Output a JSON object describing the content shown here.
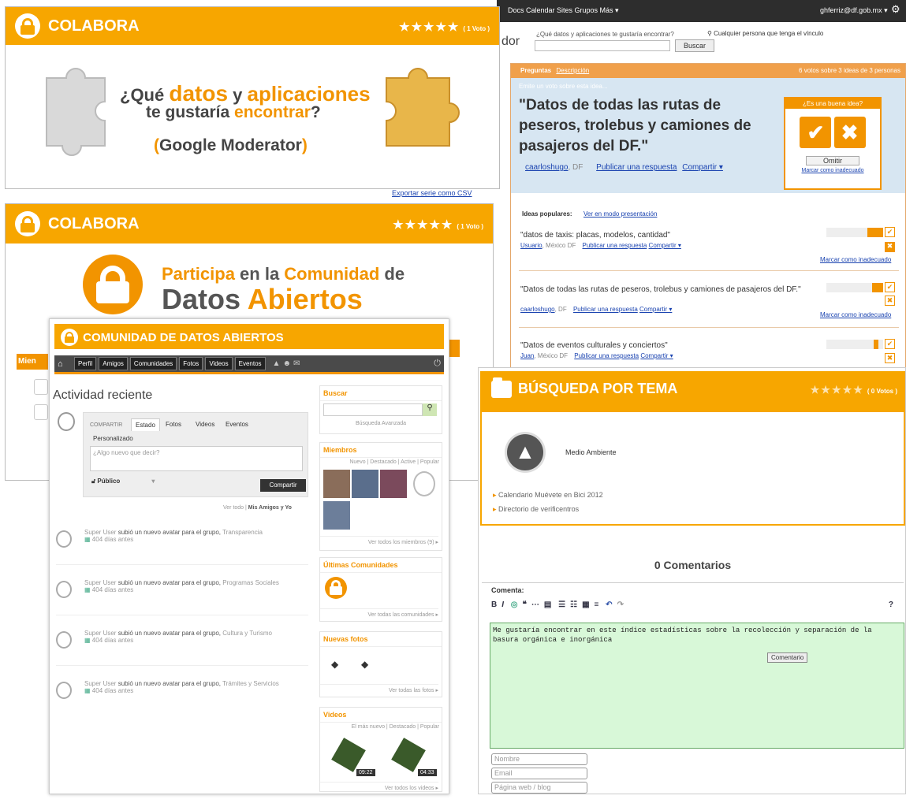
{
  "moderator": {
    "topnav": "Docs  Calendar  Sites  Grupos  Más ▾",
    "account": "ghferriz@df.gob.mx ▾",
    "brand_fragment": "dor",
    "search_prompt": "¿Qué datos y aplicaciones te gustaría encontrar?",
    "share_note": "Cualquier persona que tenga el vínculo",
    "search_button": "Buscar",
    "tab_questions": "Preguntas",
    "tab_description": "Descripción",
    "votes_summary": "6 votos sobre 3 ideas de 3 personas",
    "emit_vote": "Emite un voto sobre esta idea...",
    "idea_title": "\"Datos de todas las rutas de peseros, trolebus y camiones de pasajeros del DF.\"",
    "idea_author": "caarloshugo",
    "idea_location": ", DF",
    "publish_answer": "Publicar una respuesta",
    "share": "Compartir ▾",
    "good_idea": "¿Es una buena idea?",
    "omit": "Omitir",
    "mark_inappropriate": "Marcar como inadecuado",
    "popular_ideas": "Ideas populares:",
    "presentation_mode": "Ver en modo presentación",
    "export_link": "Exportar serie como CSV",
    "ideas": [
      {
        "text": "\"datos de taxis: placas, modelos, cantidad\"",
        "author": "Usuario",
        "loc": ", México DF",
        "publish": "Publicar una respuesta",
        "share": "Compartir ▾",
        "mark": "Marcar como inadecuado"
      },
      {
        "text": "\"Datos de todas las rutas de peseros, trolebus y camiones de pasajeros del DF.\"",
        "author": "caarloshugo",
        "loc": ", DF",
        "publish": "Publicar una respuesta",
        "share": "Compartir ▾",
        "mark": "Marcar como inadecuado"
      },
      {
        "text": "\"Datos de eventos culturales y conciertos\"",
        "author": "Juan",
        "loc": ", México DF",
        "publish": "Publicar una respuesta",
        "share": "Compartir ▾",
        "mark": ""
      }
    ]
  },
  "colabora1": {
    "title": "COLABORA",
    "stars": "★★★★★",
    "votes": "( 1 Voto )",
    "line1_a": "¿Qué ",
    "line1_b": "datos",
    "line1_c": " y ",
    "line1_d": "aplicaciones",
    "line2_a": "te gustaría ",
    "line2_b": "encontrar",
    "line2_c": "?",
    "line3_a": "(",
    "line3_b": "Google Moderator",
    "line3_c": ")"
  },
  "colabora2": {
    "title": "COLABORA",
    "stars": "★★★★★",
    "votes": "( 1 Voto )",
    "line1_a": "Participa",
    "line1_b": " en la ",
    "line1_c": "Comunidad",
    "line1_d": " de",
    "line2_a": "Datos ",
    "line2_b": "Abiertos",
    "side_fragment": "Mien"
  },
  "comunidad": {
    "title": "COMUNIDAD DE DATOS ABIERTOS",
    "nav": [
      "Perfil",
      "Amigos",
      "Comunidades",
      "Fotos",
      "Videos",
      "Eventos"
    ],
    "activity_title": "Actividad reciente",
    "share_label": "COMPARTIR",
    "share_tabs": [
      "Estado",
      "Fotos",
      "Videos",
      "Eventos"
    ],
    "personalizado": "Personalizado",
    "placeholder": "¿Algo nuevo que decir?",
    "public": "Público",
    "share_button": "Compartir",
    "filter_all": "Ver todo",
    "filter_friends": "Mis Amigos y Yo",
    "feed": [
      {
        "user": "Super User",
        "action": "subió un nuevo avatar para el grupo,",
        "group": "Transparencia",
        "time": "404 días antes"
      },
      {
        "user": "Super User",
        "action": "subió un nuevo avatar para el grupo,",
        "group": "Programas Sociales",
        "time": "404 días antes"
      },
      {
        "user": "Super User",
        "action": "subió un nuevo avatar para el grupo,",
        "group": "Cultura y Turismo",
        "time": "404 días antes"
      },
      {
        "user": "Super User",
        "action": "subió un nuevo avatar para el grupo,",
        "group": "Trámites y Servicios",
        "time": "404 días antes"
      }
    ],
    "search_title": "Buscar",
    "advanced_search": "Búsqueda Avanzada",
    "members_title": "Miembros",
    "members_tabs": "Nuevo | Destacado | Active | Popular",
    "members_more": "Ver todos los miembros (9) ▸",
    "communities_title": "Últimas Comunidades",
    "communities_more": "Ver todas las comunidades ▸",
    "photos_title": "Nuevas fotos",
    "photos_more": "Ver todas las fotos ▸",
    "videos_title": "Videos",
    "videos_tabs": "El más nuevo | Destacado | Popular",
    "video1_time": "09:22",
    "video2_time": "04:33",
    "videos_more": "Ver todos los videos ▸"
  },
  "busqueda": {
    "title": "BÚSQUEDA POR TEMA",
    "stars": "★★★★★",
    "votes": "( 0 Votos )",
    "topic": "Medio Ambiente",
    "links": [
      "Calendario Muévete en Bici 2012",
      "Directorio de verificentros"
    ],
    "comments_count": "0 Comentarios",
    "comment_label": "Comenta:",
    "comment_text": "Me gustaría encontrar en este índice estadísticas sobre la recolección y separación de la basura orgánica e inorgánica",
    "comment_button": "Comentario",
    "name_placeholder": "Nombre",
    "email_placeholder": "Email",
    "web_placeholder": "Página web / blog"
  }
}
